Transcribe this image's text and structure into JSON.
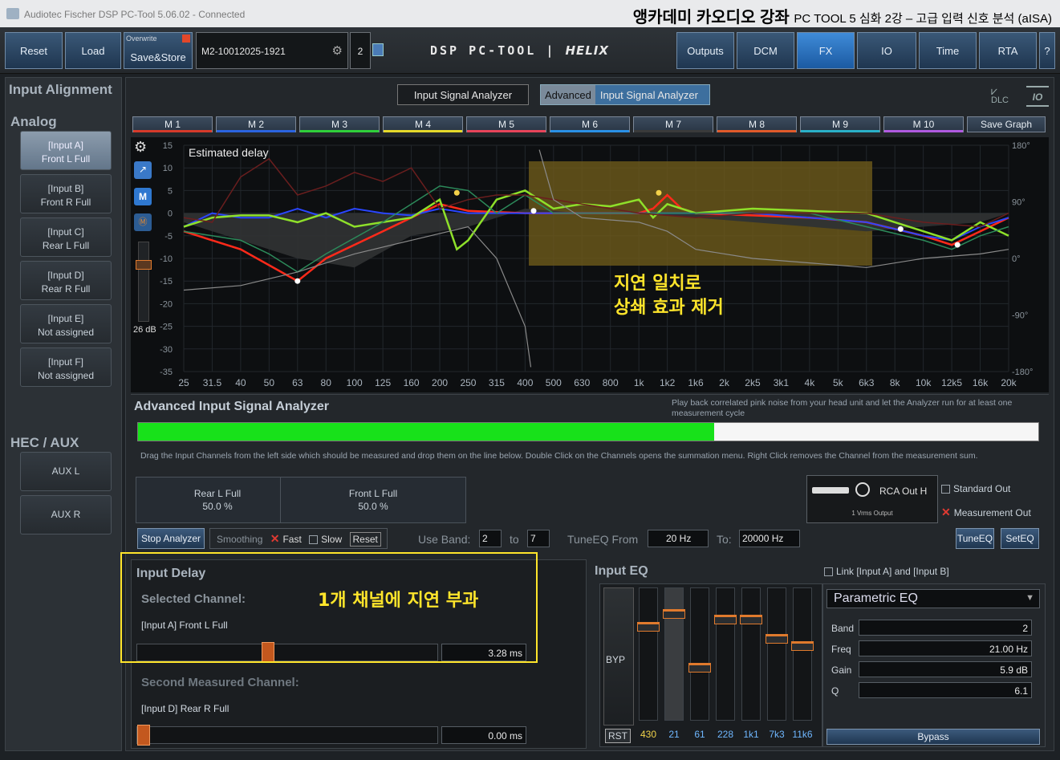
{
  "window": {
    "title": "Audiotec Fischer DSP PC-Tool 5.06.02 - Connected",
    "overlay_title": "앵카데미 카오디오 강좌",
    "overlay_subtitle": "PC TOOL 5 심화 2강 – 고급 입력 신호 분석 (aISA)"
  },
  "topbar": {
    "reset": "Reset",
    "load": "Load",
    "overwrite": "Overwrite",
    "save_store": "Save&Store",
    "preset_name": "M2-10012025-1921",
    "preset_num": "2",
    "logo_left": "DSP PC-TOOL",
    "logo_sep": "|",
    "logo_right": "HELIX",
    "tabs": [
      "Outputs",
      "DCM",
      "FX",
      "IO",
      "Time",
      "RTA"
    ],
    "help": "?",
    "active_tab": "FX"
  },
  "left": {
    "title": "Input Alignment",
    "analog": "Analog",
    "channels": [
      {
        "l1": "[Input A]",
        "l2": "Front L Full"
      },
      {
        "l1": "[Input B]",
        "l2": "Front R Full"
      },
      {
        "l1": "[Input C]",
        "l2": "Rear L Full"
      },
      {
        "l1": "[Input D]",
        "l2": "Rear R Full"
      },
      {
        "l1": "[Input E]",
        "l2": "Not assigned"
      },
      {
        "l1": "[Input F]",
        "l2": "Not assigned"
      }
    ],
    "hec": "HEC / AUX",
    "aux": [
      "AUX L",
      "AUX R"
    ]
  },
  "analyzer_tabs": {
    "tab1": "Input Signal Analyzer",
    "tab2_prefix": "Advanced",
    "tab2": "Input Signal Analyzer",
    "dlc": "DLC",
    "io": "IO"
  },
  "memories": [
    {
      "label": "M 1",
      "color": "#d63a2a"
    },
    {
      "label": "M 2",
      "color": "#2b64e0"
    },
    {
      "label": "M 3",
      "color": "#2fcf3a"
    },
    {
      "label": "M 4",
      "color": "#e5d92a"
    },
    {
      "label": "M 5",
      "color": "#e8445a"
    },
    {
      "label": "M 6",
      "color": "#2a90e6"
    },
    {
      "label": "M 7",
      "color": "#3a3a3a"
    },
    {
      "label": "M 8",
      "color": "#e05a2a"
    },
    {
      "label": "M 9",
      "color": "#2ab0c8"
    },
    {
      "label": "M 10",
      "color": "#b05ae0"
    }
  ],
  "save_graph": "Save Graph",
  "graph": {
    "estimated_delay": "Estimated delay",
    "gain_label": "26 dB",
    "m_label": "M",
    "yleft": [
      "15",
      "10",
      "5",
      "0",
      "-5",
      "-10",
      "-15",
      "-20",
      "-25",
      "-30",
      "-35"
    ],
    "yright": [
      "180°",
      "90°",
      "0°",
      "-90°",
      "-180°"
    ],
    "xticks": [
      "25",
      "31.5",
      "40",
      "50",
      "63",
      "80",
      "100",
      "125",
      "160",
      "200",
      "250",
      "315",
      "400",
      "500",
      "630",
      "800",
      "1k",
      "1k2",
      "1k6",
      "2k",
      "2k5",
      "3k1",
      "4k",
      "5k",
      "6k3",
      "8k",
      "10k",
      "12k5",
      "16k",
      "20k"
    ],
    "annotation_l1": "지연 일치로",
    "annotation_l2": "상쇄 효과 제거"
  },
  "aisa": {
    "title": "Advanced Input Signal Analyzer",
    "hint": "Play back correlated pink noise from your head unit and let the Analyzer run for at least one measurement cycle",
    "progress": 0.64,
    "instructions": "Drag the Input Channels from the left side which should be measured and drop them on the line below. Double Click on the Channels opens the summation menu. Right Click removes the Channel from the measurement sum.",
    "sum": [
      {
        "name": "Rear L Full",
        "pct": "50.0 %"
      },
      {
        "name": "Front L Full",
        "pct": "50.0 %"
      }
    ],
    "rca_label": "RCA Out H",
    "rca_sub": "1 Vrms Output",
    "standard_out": "Standard Out",
    "measurement_out": "Measurement Out",
    "stop": "Stop Analyzer",
    "smoothing": "Smoothing",
    "fast": "Fast",
    "slow": "Slow",
    "reset": "Reset",
    "use_band": "Use Band:",
    "band_from": "2",
    "to": "to",
    "band_to": "7",
    "tuneeq_from": "TuneEQ From",
    "from_val": "20 Hz",
    "to_label": "To:",
    "to_val": "20000 Hz",
    "tuneeq": "TuneEQ",
    "seteq": "SetEQ"
  },
  "delay": {
    "title": "Input Delay",
    "selected": "Selected Channel:",
    "selected_ch": "[Input A] Front L Full",
    "selected_val": "3.28 ms",
    "selected_pos": 0.43,
    "second": "Second Measured Channel:",
    "second_ch": "[Input D] Rear R Full",
    "second_val": "0.00 ms",
    "second_pos": 0.0,
    "annotation": "1개 채널에 지연 부과"
  },
  "eq": {
    "title": "Input EQ",
    "link": "Link [Input A] and [Input B]",
    "byp": "BYP",
    "rst": "RST",
    "bands": [
      "430",
      "21",
      "61",
      "228",
      "1k1",
      "7k3",
      "11k6"
    ],
    "type": "Parametric EQ",
    "band_label": "Band",
    "band": "2",
    "freq_label": "Freq",
    "freq": "21.00 Hz",
    "gain_label": "Gain",
    "gain": "5.9 dB",
    "q_label": "Q",
    "q": "6.1",
    "bypass": "Bypass"
  }
}
